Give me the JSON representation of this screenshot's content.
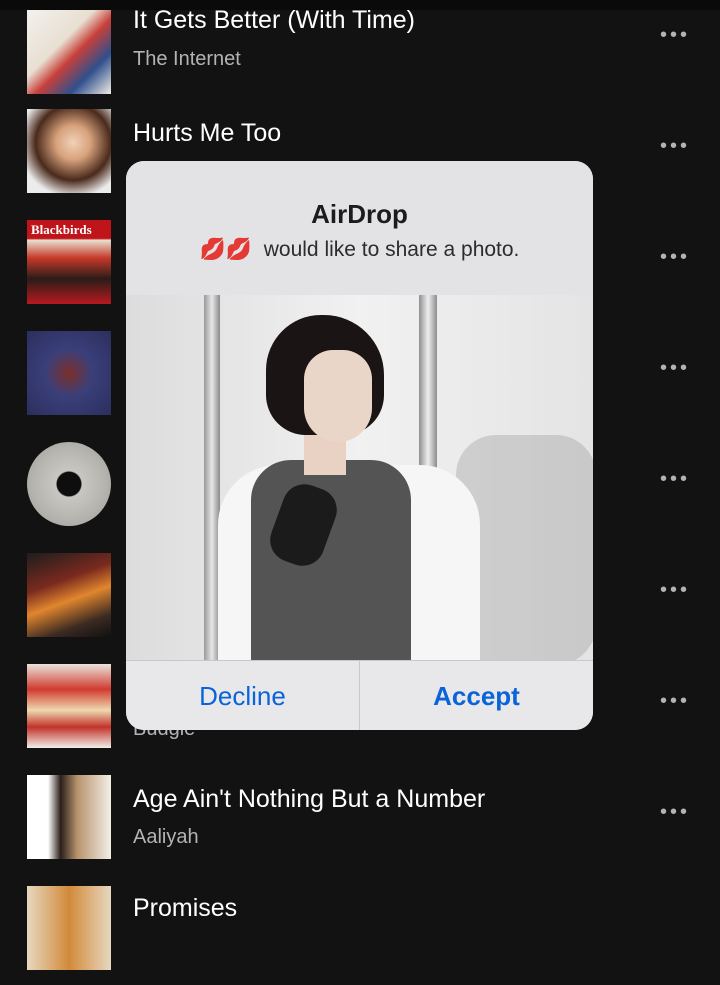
{
  "tracks": [
    {
      "title": "It Gets Better (With Time)",
      "artist": "The Internet",
      "more": "•••"
    },
    {
      "title": "Hurts Me Too",
      "artist": "",
      "more": "•••"
    },
    {
      "title": "",
      "artist": "",
      "more": "•••"
    },
    {
      "title": "",
      "artist": "",
      "more": "•••"
    },
    {
      "title": "",
      "artist": "",
      "more": "•••"
    },
    {
      "title": "",
      "artist": "",
      "more": "•••"
    },
    {
      "title": "",
      "artist": "Budgie",
      "more": "•••"
    },
    {
      "title": "Age Ain't Nothing But a Number",
      "artist": "Aaliyah",
      "more": "•••"
    },
    {
      "title": "Promises",
      "artist": "",
      "more": ""
    }
  ],
  "art_text": {
    "blackbirds": "Blackbirds"
  },
  "airdrop": {
    "title": "AirDrop",
    "sender_emoji": "💋💋",
    "message": "would like to share a photo.",
    "decline_label": "Decline",
    "accept_label": "Accept"
  },
  "colors": {
    "background": "#121212",
    "accent_blue": "#0a64d8",
    "dialog_bg": "#e8e8ea"
  }
}
